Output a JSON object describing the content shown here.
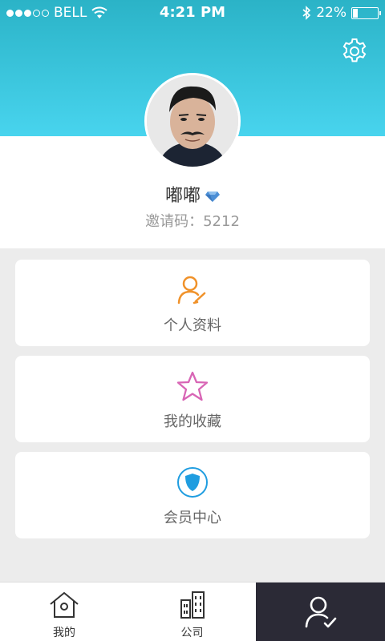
{
  "status_bar": {
    "carrier": "BELL",
    "time": "4:21 PM",
    "battery": "22%",
    "battery_level": 0.22
  },
  "profile": {
    "name": "嘟嘟",
    "invite_code": "邀请码：5212",
    "badge_icon": "diamond-icon"
  },
  "menu": {
    "items": [
      {
        "label": "个人资料",
        "icon": "user-edit-icon",
        "color": "#f0922a"
      },
      {
        "label": "我的收藏",
        "icon": "star-icon",
        "color": "#d865b5"
      },
      {
        "label": "会员中心",
        "icon": "shield-icon",
        "color": "#1f9de0"
      }
    ]
  },
  "tabbar": {
    "items": [
      {
        "label": "我的",
        "icon": "home-icon"
      },
      {
        "label": "公司",
        "icon": "building-icon"
      },
      {
        "label": "",
        "icon": "user-check-icon",
        "active": true
      }
    ]
  },
  "colors": {
    "header_top": "#2bb3c7",
    "header_bottom": "#48d4ee",
    "tab_active_bg": "#2b2a36"
  }
}
